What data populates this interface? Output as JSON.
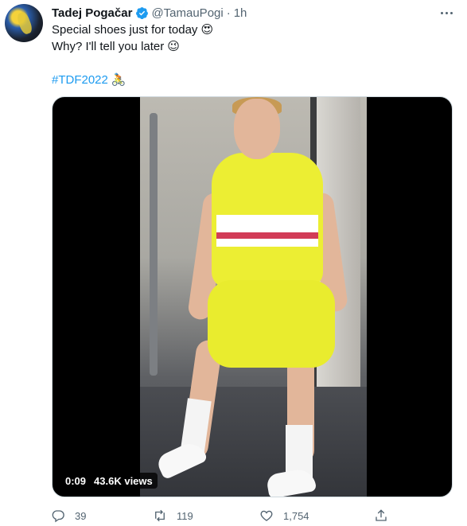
{
  "tweet": {
    "author_name": "Tadej Pogačar",
    "handle": "@TamauPogi",
    "separator": "·",
    "time": "1h",
    "line1": "Special shoes just for today",
    "line1_emoji": "😍",
    "line2": "Why? I'll tell you later",
    "line2_emoji": "😉",
    "hashtag": "#TDF2022",
    "hashtag_emoji": "🚴"
  },
  "media": {
    "type": "video",
    "duration": "0:09",
    "views": "43.6K views"
  },
  "actions": {
    "reply_count": "39",
    "retweet_count": "119",
    "like_count": "1,754"
  },
  "icons": {
    "verified": "verified-badge-icon",
    "more": "more-options-icon",
    "reply": "reply-icon",
    "retweet": "retweet-icon",
    "like": "heart-icon",
    "share": "share-icon"
  },
  "colors": {
    "accent": "#1d9bf0",
    "text_primary": "#0f1419",
    "text_secondary": "#536471"
  }
}
